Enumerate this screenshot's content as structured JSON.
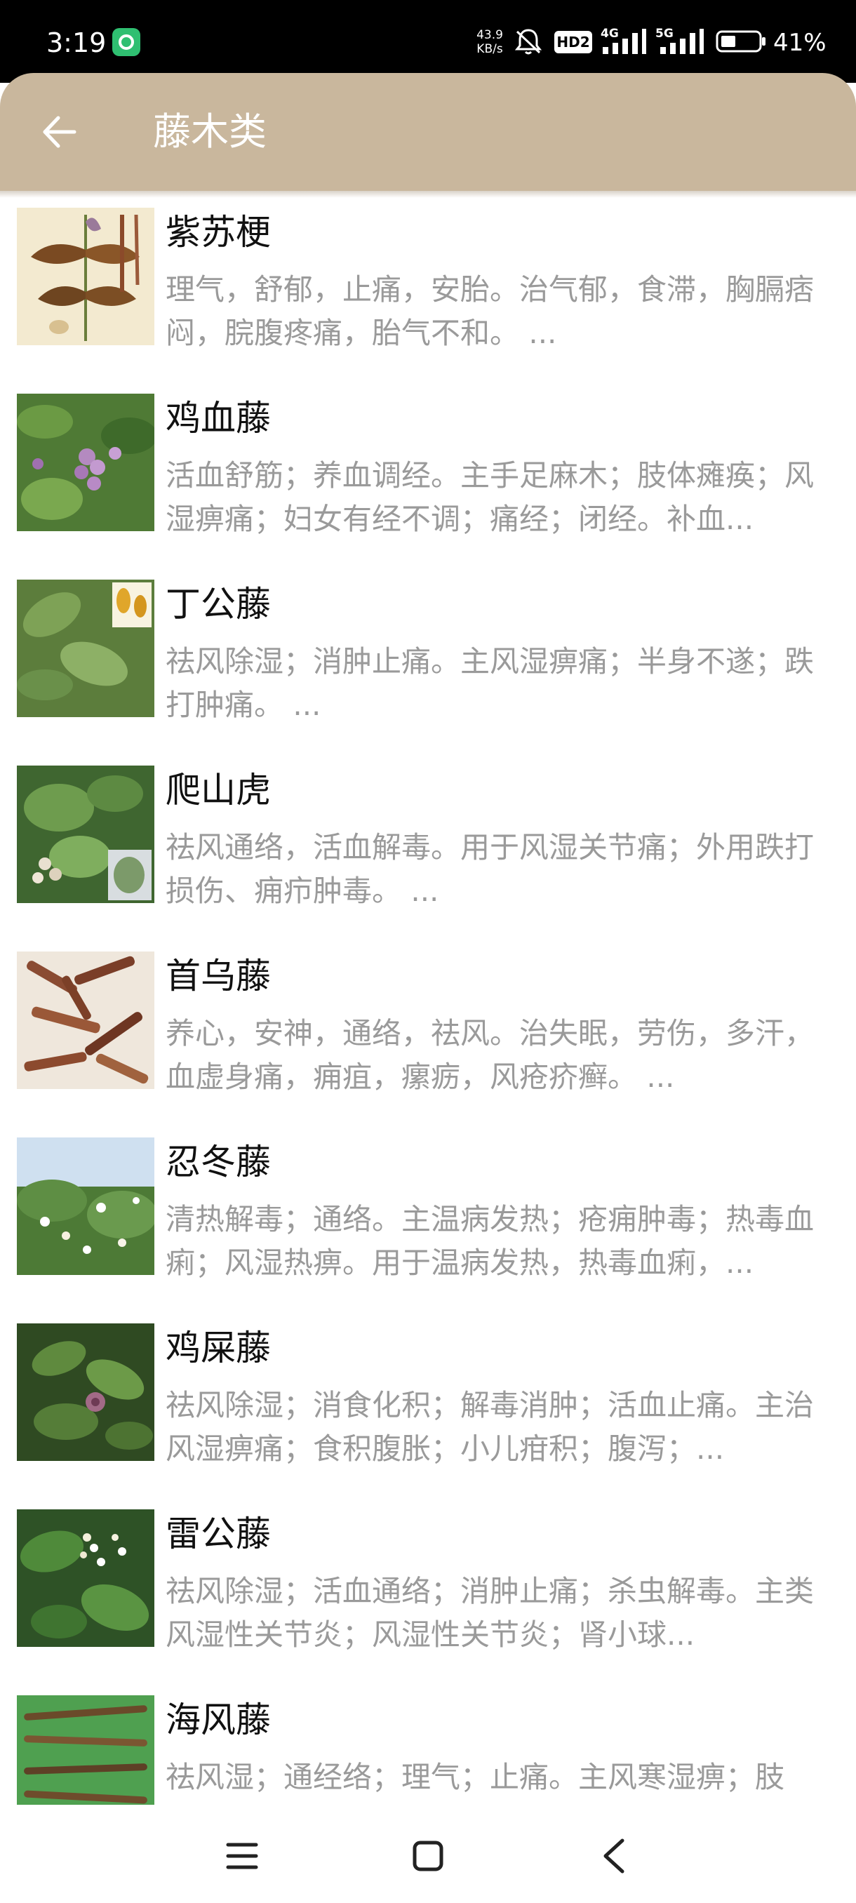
{
  "status_bar": {
    "time": "3:19",
    "net_speed_value": "43.9",
    "net_speed_unit": "KB/s",
    "hd_label": "HD2",
    "net_4g": "4G",
    "net_5g": "5G",
    "battery_percent": "41%"
  },
  "header": {
    "title": "藤木类"
  },
  "items": [
    {
      "name": "紫苏梗",
      "desc": "理气，舒郁，止痛，安胎。治气郁，食滞，胸膈痞闷，脘腹疼痛，胎气不和。 ..."
    },
    {
      "name": "鸡血藤",
      "desc": "活血舒筋；养血调经。主手足麻木；肢体瘫痪；风湿痹痛；妇女有经不调；痛经；闭经。补血..."
    },
    {
      "name": "丁公藤",
      "desc": "祛风除湿；消肿止痛。主风湿痹痛；半身不遂；跌打肿痛。 ..."
    },
    {
      "name": "爬山虎",
      "desc": "祛风通络，活血解毒。用于风湿关节痛；外用跌打损伤、痈疖肿毒。 ..."
    },
    {
      "name": "首乌藤",
      "desc": "养心，安神，通络，祛风。治失眠，劳伤，多汗，血虚身痛，痈疽，瘰疬，风疮疥癣。 ..."
    },
    {
      "name": "忍冬藤",
      "desc": "清热解毒；通络。主温病发热；疮痈肿毒；热毒血痢；风湿热痹。用于温病发热，热毒血痢，..."
    },
    {
      "name": "鸡屎藤",
      "desc": "祛风除湿；消食化积；解毒消肿；活血止痛。主治风湿痹痛；食积腹胀；小儿疳积；腹泻；..."
    },
    {
      "name": "雷公藤",
      "desc": "祛风除湿；活血通络；消肿止痛；杀虫解毒。主类风湿性关节炎；风湿性关节炎；肾小球..."
    },
    {
      "name": "海风藤",
      "desc": "祛风湿；通经络；理气；止痛。主风寒湿痹；肢"
    }
  ],
  "colors": {
    "app_bar": "#c9b79d",
    "title_text": "#ffffff",
    "item_name": "#111111",
    "item_desc": "#9a9a9a"
  },
  "icons": {
    "back": "arrow-left-icon",
    "nav_menu": "menu-icon",
    "nav_home": "home-square-icon",
    "nav_back": "chevron-left-icon"
  }
}
